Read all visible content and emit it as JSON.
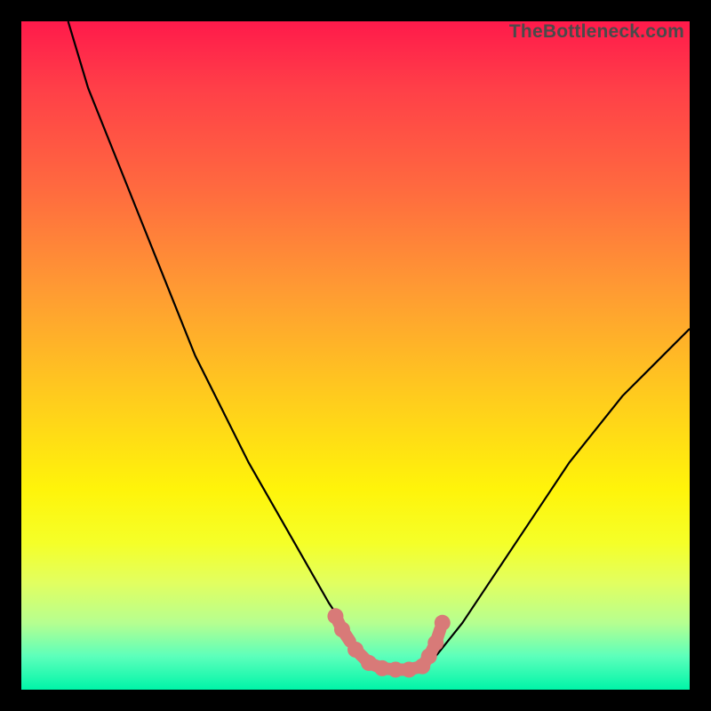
{
  "watermark": "TheBottleneck.com",
  "chart_data": {
    "type": "line",
    "title": "",
    "xlabel": "",
    "ylabel": "",
    "xlim": [
      0,
      100
    ],
    "ylim": [
      0,
      100
    ],
    "grid": false,
    "background": "rainbow-gradient",
    "series": [
      {
        "name": "bottleneck-curve",
        "color": "#000000",
        "x": [
          7,
          10,
          14,
          18,
          22,
          26,
          30,
          34,
          38,
          42,
          46,
          48,
          50,
          52,
          54,
          56,
          58,
          60,
          62,
          66,
          70,
          74,
          78,
          82,
          86,
          90,
          94,
          98,
          100
        ],
        "values": [
          100,
          90,
          80,
          70,
          60,
          50,
          42,
          34,
          27,
          20,
          13,
          10,
          7,
          5,
          3.5,
          3,
          3,
          3.5,
          5,
          10,
          16,
          22,
          28,
          34,
          39,
          44,
          48,
          52,
          54
        ]
      },
      {
        "name": "optimal-range-highlight",
        "color": "#d87a78",
        "style": "thick-dotted",
        "x": [
          47,
          48,
          50,
          52,
          54,
          56,
          58,
          60,
          61,
          62,
          63
        ],
        "values": [
          11,
          9,
          6,
          4,
          3.2,
          3,
          3,
          3.5,
          5,
          7,
          10
        ]
      }
    ]
  }
}
